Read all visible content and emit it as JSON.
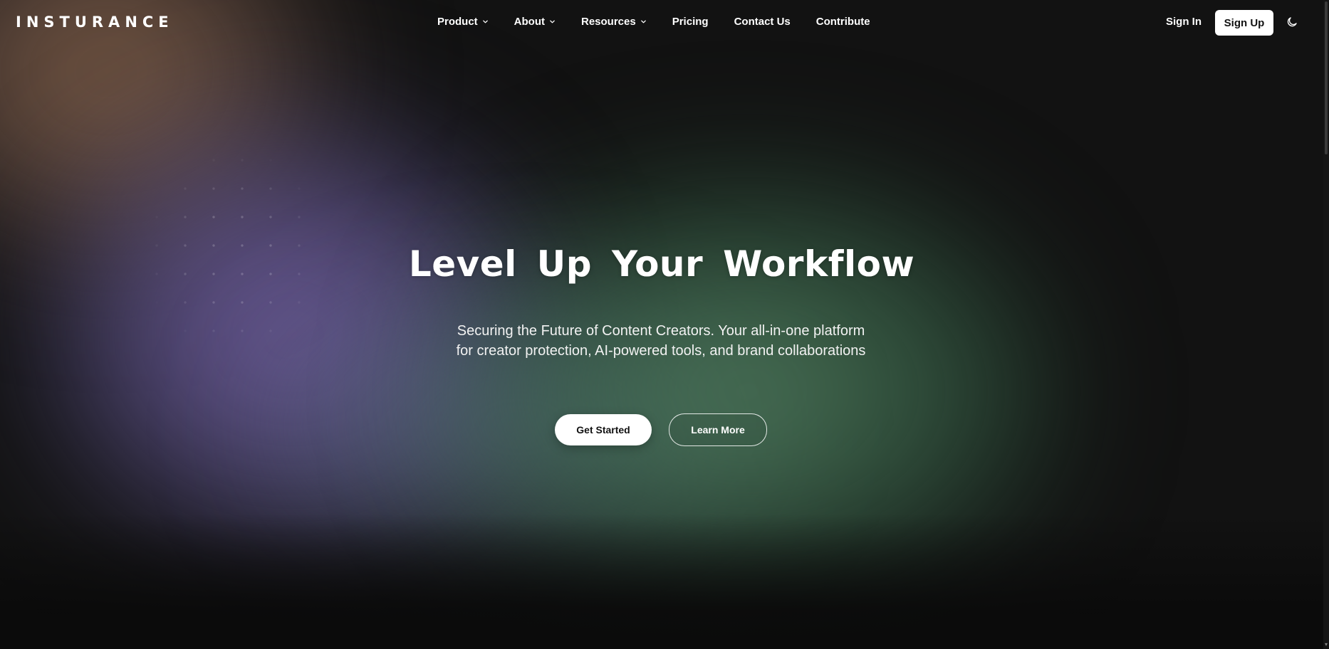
{
  "brand": {
    "logo_text": "INSTURANCE"
  },
  "nav": {
    "items": [
      {
        "label": "Product",
        "has_dropdown": true
      },
      {
        "label": "About",
        "has_dropdown": true
      },
      {
        "label": "Resources",
        "has_dropdown": true
      },
      {
        "label": "Pricing",
        "has_dropdown": false
      },
      {
        "label": "Contact Us",
        "has_dropdown": false
      },
      {
        "label": "Contribute",
        "has_dropdown": false
      }
    ],
    "sign_in_label": "Sign In",
    "sign_up_label": "Sign Up",
    "theme_toggle_icon": "moon-icon"
  },
  "hero": {
    "title": "Level Up Your Workflow",
    "subtitle": "Securing the Future of Content Creators. Your all-in-one platform for creator protection, AI-powered tools, and brand collaborations",
    "primary_cta": "Get Started",
    "secondary_cta": "Learn More"
  },
  "colors": {
    "background": "#121212",
    "primary_button_bg": "#ffffff",
    "primary_button_text": "#111111",
    "glow_brown": "#967050",
    "glow_purple": "#7864aa",
    "glow_green": "#5a8c69"
  }
}
